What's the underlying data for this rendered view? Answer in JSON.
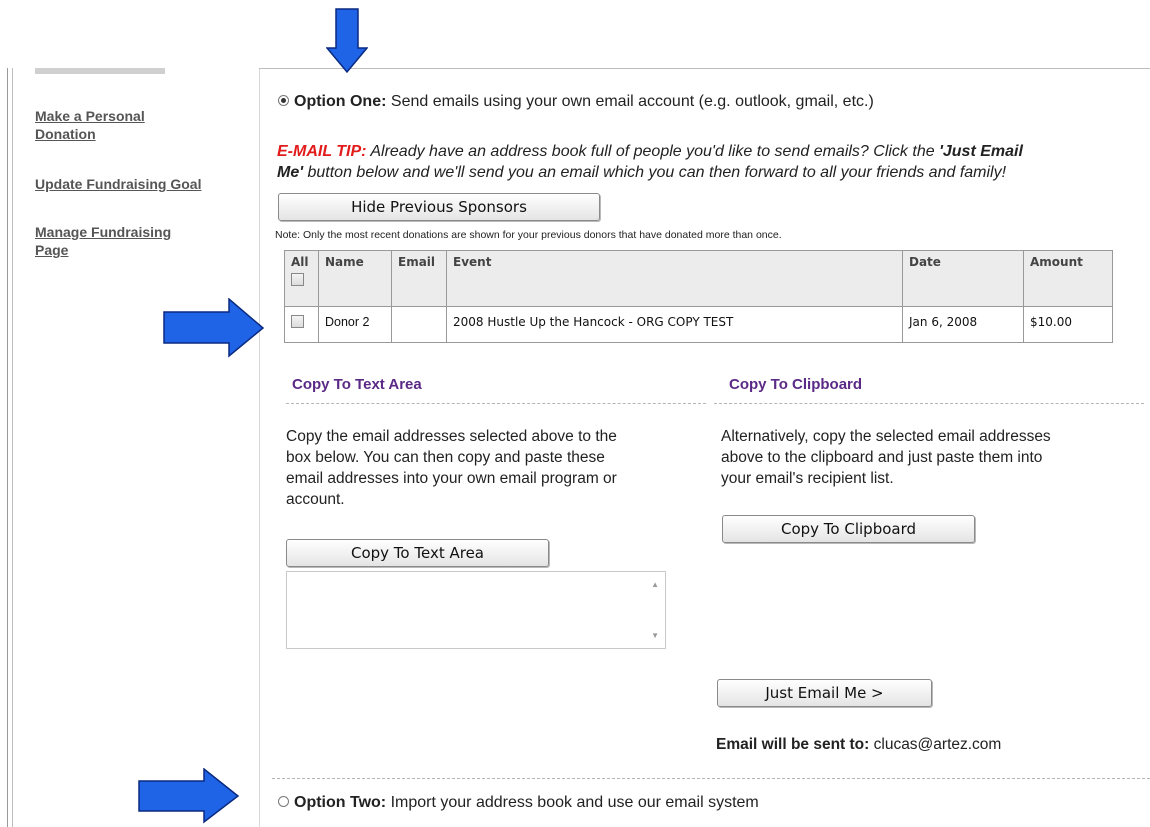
{
  "sidebar": {
    "items": [
      {
        "label_line1": "Make a Personal",
        "label_line2": "Donation"
      },
      {
        "label_line1": "Update Fundraising Goal",
        "label_line2": ""
      },
      {
        "label_line1": "Manage Fundraising",
        "label_line2": "Page"
      }
    ]
  },
  "option_one": {
    "label": "Option One:",
    "text": "Send emails using your own email account (e.g. outlook, gmail, etc.)",
    "selected": true
  },
  "tip": {
    "prefix": "E-MAIL TIP:",
    "text_a": "Already have an address book full of people you'd like to send emails? Click the",
    "bold_a": "'Just Email",
    "bold_b": "Me'",
    "text_b": "button below and we'll send you an email which you can then forward to all your friends and family!"
  },
  "hide_sponsors_button": "Hide Previous Sponsors",
  "note": "Note: Only the most recent donations are shown for your previous donors that have donated more than once.",
  "table": {
    "headers": [
      "All",
      "Name",
      "Email",
      "Event",
      "Date",
      "Amount"
    ],
    "rows": [
      {
        "name": "Donor 2",
        "email": "",
        "event": "2008 Hustle Up the Hancock - ORG COPY TEST",
        "date": "Jan 6, 2008",
        "amount": "$10.00"
      }
    ]
  },
  "copy_text_area": {
    "title": "Copy To Text Area",
    "line1": "Copy the email addresses selected above to the",
    "line2": "box below. You can then copy and paste these",
    "line3": "email addresses into your own email program or",
    "line4": "account.",
    "button": "Copy To Text Area",
    "textarea_value": ""
  },
  "copy_clipboard": {
    "title": "Copy To Clipboard",
    "line1": "Alternatively, copy the selected email addresses",
    "line2": "above to the clipboard and just paste them into",
    "line3": "your email's recipient list.",
    "button": "Copy To Clipboard"
  },
  "just_email": {
    "button": "Just Email Me >",
    "sent_to_label": "Email will be sent to:",
    "sent_to_value": "clucas@artez.com"
  },
  "option_two": {
    "label": "Option Two:",
    "text": "Import your address book and use our email system",
    "selected": false
  },
  "colors": {
    "arrow": "#1f63e6",
    "tip_red": "#e21b1b",
    "section_purple": "#5b2a86"
  },
  "icons": [
    "down-arrow-icon",
    "right-arrow-icon",
    "scroll-up-icon",
    "scroll-down-icon"
  ]
}
